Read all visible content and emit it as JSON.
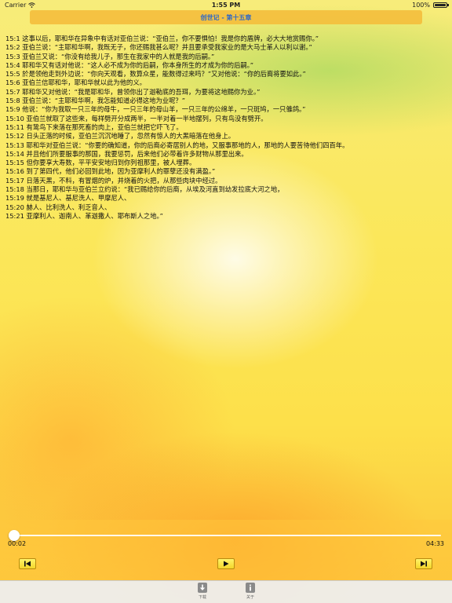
{
  "status_bar": {
    "carrier": "Carrier",
    "time": "1:55 PM",
    "battery": "100%",
    "battery_level": 1.0
  },
  "header": {
    "title": "创世记 - 第十五章"
  },
  "verses": [
    "15:1 这事以后，耶和华在异象中有话对亚伯兰说：“亚伯兰，你不要惧怕！我是你的盾牌，必大大地赏赐你。”",
    "15:2 亚伯兰说：“主耶和华啊，我既无子，你还赐我甚么呢？并且要承受我家业的是大马士革人以利以谢。”",
    "15:3 亚伯兰又说：“你没有给我儿子，那生在我家中的人就是我的后嗣。”",
    "15:4 耶和华又有话对他说：“这人必不成为你的后嗣，你本身所生的才成为你的后嗣。”",
    "15:5 於是领他走到外边说：“你向天观看，数算众星，能数得过来吗？”又对他说：“你的后裔将要如此。”",
    "15:6 亚伯兰信耶和华，耶和华就以此为他的义。",
    "15:7 耶和华又对他说：“我是耶和华，曾领你出了迦勒底的吾珥，为要将这地赐你为业。”",
    "15:8 亚伯兰说：“主耶和华啊，我怎能知道必得这地为业呢？”",
    "15:9 他说：“你为我取一只三年的母牛，一只三年的母山羊，一只三年的公绵羊，一只斑鸠，一只雏鸽。”",
    "15:10 亚伯兰就取了这些来，每样劈开分成两半，一半对着一半地摆列，只有鸟没有劈开。",
    "15:11 有鸷鸟下来落在那死畜的肉上，亚伯兰就把它吓飞了。",
    "15:12 日头正落的时候，亚伯兰沉沉地睡了，忽然有惊人的大黑暗落在他身上。",
    "15:13 耶和华对亚伯兰说：“你要的确知道，你的后裔必寄居别人的地，又服事那地的人，那地的人要苦待他们四百年。",
    "15:14 并且他们所要服事的那国，我要惩罚，后来他们必带着许多财物从那里出来。",
    "15:15 但你要享大寿数，平平安安地归到你列祖那里，被人埋葬。",
    "15:16 到了第四代，他们必回到此地，因为亚摩利人的罪孽还没有满盈。”",
    "15:17 日落天黑，不料，有冒烟的炉，并烧着的火把，从那些肉块中经过。",
    "15:18 当那日，耶和华与亚伯兰立约说：“我已赐给你的后裔，从埃及河直到幼发拉底大河之地，",
    "15:19 就是基尼人、基尼洗人、甲摩尼人、",
    "15:20 赫人、比利洗人、利乏音人、",
    "15:21 亚摩利人、迦南人、革迦撒人、耶布斯人之地。”"
  ],
  "player": {
    "elapsed": "00:02",
    "total": "04:33",
    "progress": 0.008
  },
  "colors": {
    "title_text": "#2c66c8",
    "title_bar": "#f4be3c"
  },
  "icons": {
    "prev": "skip-back-icon",
    "play": "play-icon",
    "next": "skip-forward-icon",
    "download": "download-icon",
    "about": "info-icon"
  },
  "tabs": [
    {
      "label": "下载"
    },
    {
      "label": "关于"
    }
  ]
}
